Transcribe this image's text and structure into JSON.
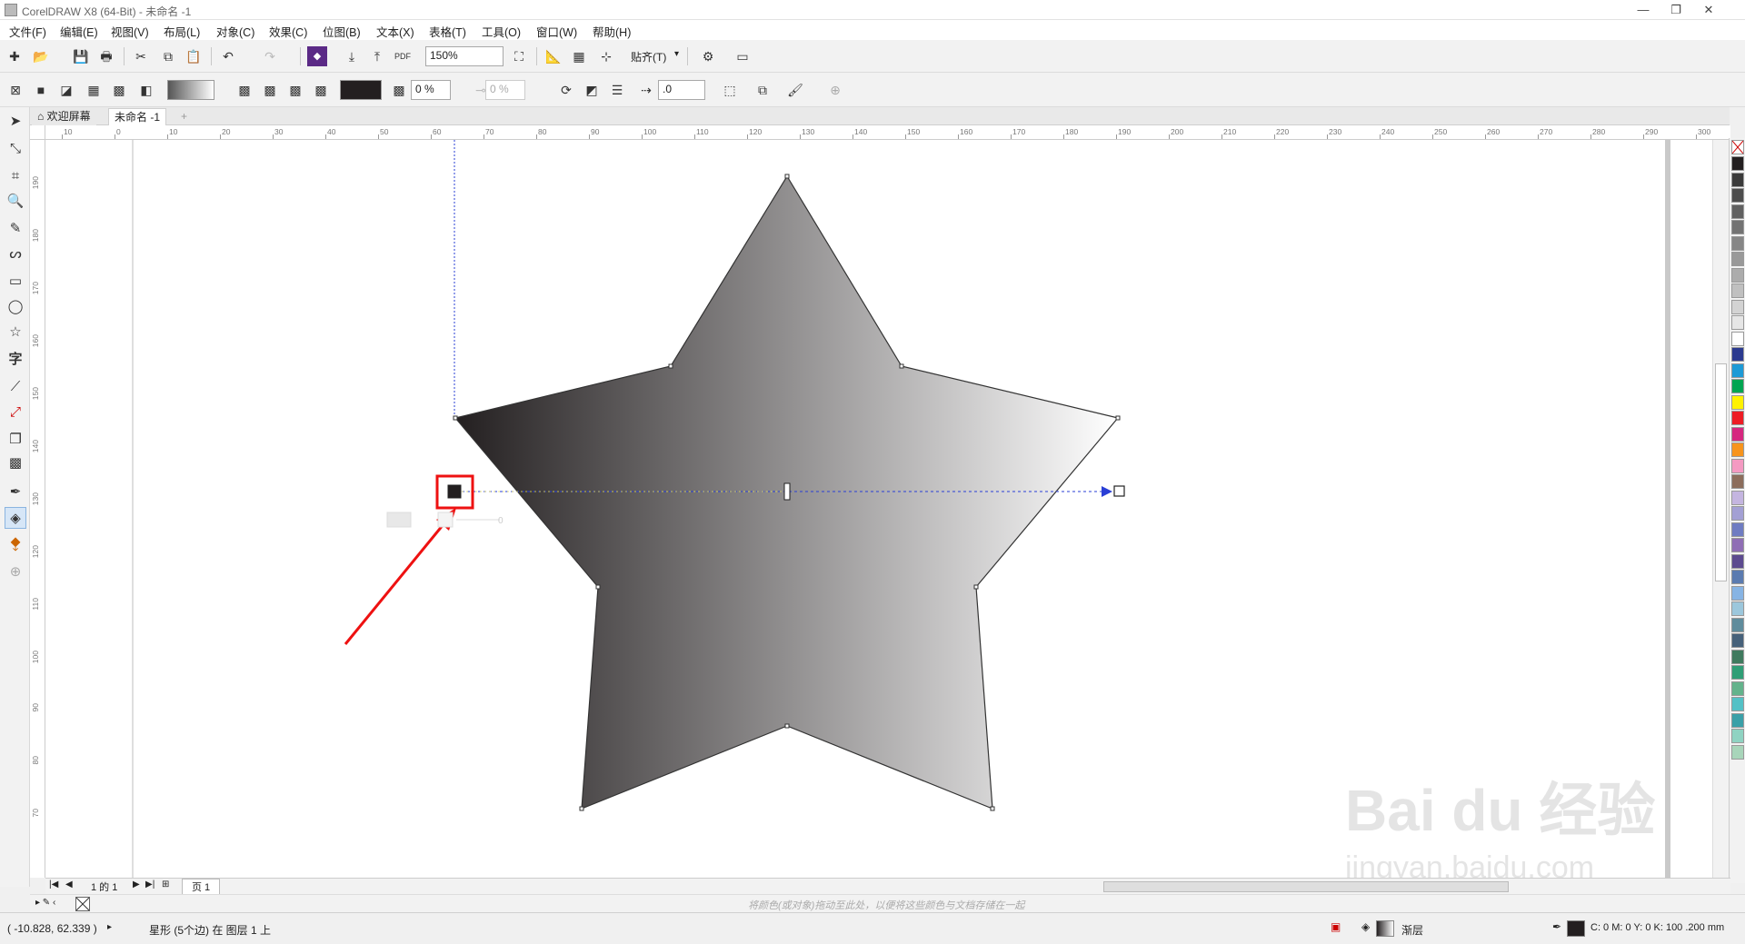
{
  "window": {
    "title": "CorelDRAW X8 (64-Bit) - 未命名 -1",
    "minimize": "—",
    "restore": "❐",
    "close": "✕"
  },
  "menu": [
    "文件(F)",
    "编辑(E)",
    "视图(V)",
    "布局(L)",
    "对象(C)",
    "效果(C)",
    "位图(B)",
    "文本(X)",
    "表格(T)",
    "工具(O)",
    "窗口(W)",
    "帮助(H)"
  ],
  "toolbar": {
    "zoom_value": "150%",
    "snap_label": "贴齐(T)",
    "pdf_label": "PDF"
  },
  "propbar": {
    "opacity1": "0 %",
    "opacity2": "0 %",
    "angle_value": ".0"
  },
  "tabs": {
    "welcome": "欢迎屏幕",
    "document": "未命名 -1",
    "add": "+"
  },
  "ruler": {
    "h_labels": [
      "10",
      "0",
      "10",
      "20",
      "30",
      "40",
      "50",
      "60",
      "70",
      "80",
      "90",
      "100",
      "110",
      "120",
      "130",
      "140",
      "150",
      "160",
      "170",
      "180",
      "190",
      "200",
      "210",
      "220",
      "230",
      "240",
      "250",
      "260",
      "270",
      "280",
      "290",
      "300"
    ],
    "v_labels": [
      "190",
      "180",
      "170",
      "160",
      "150",
      "140",
      "130",
      "120",
      "110",
      "100",
      "90",
      "80",
      "70"
    ]
  },
  "canvas": {
    "gradient": {
      "start": "#231f20",
      "end": "#ffffff"
    },
    "node_mini_value": "0"
  },
  "palette": [
    "#231f20",
    "#3a3a3a",
    "#4d4d4d",
    "#606060",
    "#737373",
    "#868686",
    "#999999",
    "#acacac",
    "#c0c0c0",
    "#d3d3d3",
    "#e6e6e6",
    "#ffffff",
    "#2b3a8f",
    "#1d9ad6",
    "#00a551",
    "#fff200",
    "#ed1c24",
    "#d6277f",
    "#f7941d",
    "#f49ac2",
    "#8c6d5c",
    "#c4b5e0",
    "#a3a0d4",
    "#6f7cc2",
    "#8f6eb5",
    "#5c4a8f",
    "#5b7bb0",
    "#87b4e4",
    "#9cc7dc",
    "#5f8c9c",
    "#46617a",
    "#3f7a5e",
    "#2f9e76",
    "#63b38c",
    "#53c1c6",
    "#3aa0a8",
    "#8fd3c2",
    "#a8d5ba"
  ],
  "pagebar": {
    "page_of": "1 的 1",
    "page_tab": "页 1"
  },
  "dropbar": {
    "hint": "将颜色(或对象)拖动至此处，以便将这些颜色与文档存储在一起"
  },
  "status": {
    "coords": "( -10.828, 62.339 )",
    "object_info": "星形 (5个边) 在 图层 1 上",
    "fill_label": "渐层",
    "outline_info": "C: 0 M: 0 Y: 0 K: 100  .200 mm"
  },
  "watermark": {
    "brand": "Bai du 经验",
    "url": "jingyan.baidu.com"
  }
}
